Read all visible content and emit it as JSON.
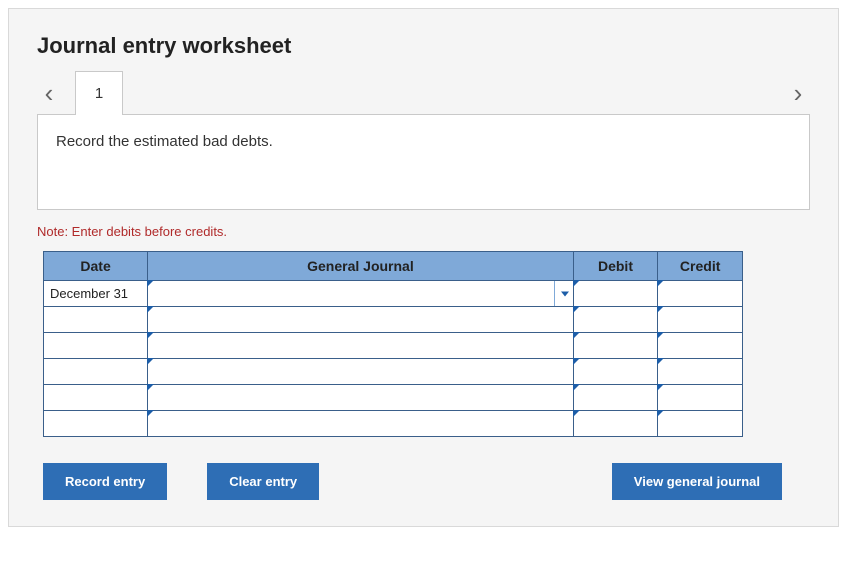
{
  "title": "Journal entry worksheet",
  "nav": {
    "prev": "‹",
    "next": "›"
  },
  "tabs": [
    "1"
  ],
  "instruction": "Record the estimated bad debts.",
  "note": "Note: Enter debits before credits.",
  "table": {
    "headers": {
      "date": "Date",
      "gj": "General Journal",
      "debit": "Debit",
      "credit": "Credit"
    },
    "rows": [
      {
        "date": "December 31",
        "gj": "",
        "debit": "",
        "credit": ""
      },
      {
        "date": "",
        "gj": "",
        "debit": "",
        "credit": ""
      },
      {
        "date": "",
        "gj": "",
        "debit": "",
        "credit": ""
      },
      {
        "date": "",
        "gj": "",
        "debit": "",
        "credit": ""
      },
      {
        "date": "",
        "gj": "",
        "debit": "",
        "credit": ""
      },
      {
        "date": "",
        "gj": "",
        "debit": "",
        "credit": ""
      }
    ]
  },
  "buttons": {
    "record": "Record entry",
    "clear": "Clear entry",
    "view": "View general journal"
  }
}
